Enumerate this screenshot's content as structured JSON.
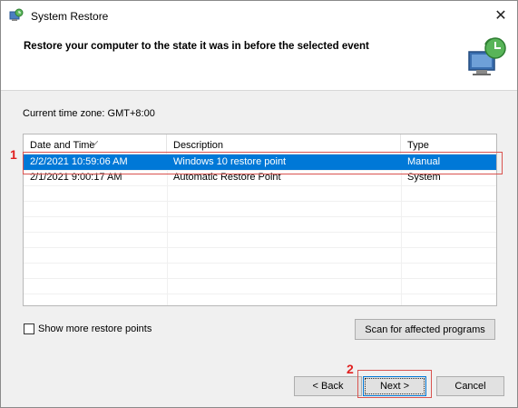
{
  "window": {
    "title": "System Restore",
    "close_glyph": "✕"
  },
  "header": {
    "text": "Restore your computer to the state it was in before the selected event",
    "icon": "system-restore-icon"
  },
  "timezone": "Current time zone: GMT+8:00",
  "table": {
    "columns": [
      "Date and Time",
      "Description",
      "Type"
    ],
    "rows": [
      {
        "date": "2/2/2021 10:59:06 AM",
        "description": "Windows 10 restore point",
        "type": "Manual",
        "selected": true
      },
      {
        "date": "2/1/2021 9:00:17 AM",
        "description": "Automatic Restore Point",
        "type": "System",
        "selected": false
      }
    ]
  },
  "options": {
    "show_more_label": "Show more restore points",
    "scan_label": "Scan for affected programs"
  },
  "footer": {
    "back_label": "< Back",
    "next_label": "Next >",
    "cancel_label": "Cancel"
  },
  "annotations": {
    "step1": "1",
    "step2": "2",
    "color": "#e02020"
  },
  "colors": {
    "selection": "#0078d7"
  }
}
